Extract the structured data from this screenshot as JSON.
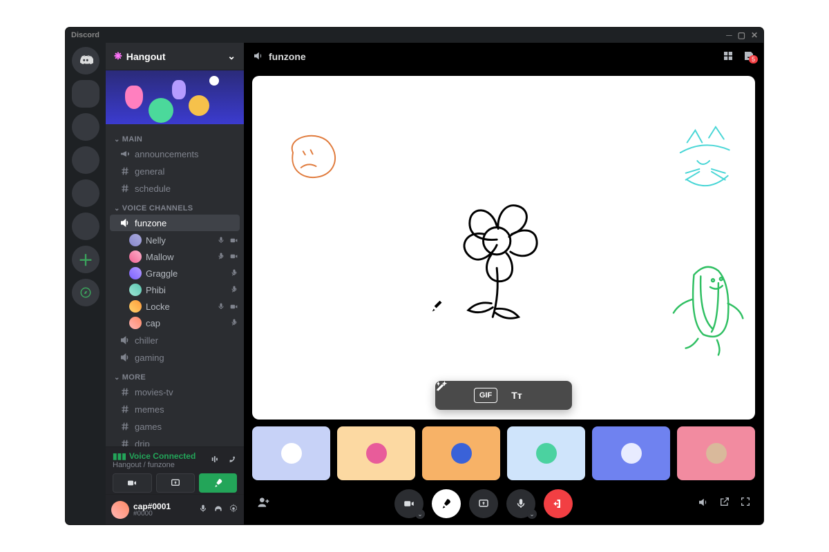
{
  "app_title": "Discord",
  "server_name": "Hangout",
  "inbox_badge": "5",
  "current_channel": {
    "icon": "speaker",
    "name": "funzone"
  },
  "categories": [
    {
      "id": "main",
      "label": "MAIN",
      "channels": [
        {
          "icon": "megaphone",
          "label": "announcements"
        },
        {
          "icon": "hash",
          "label": "general"
        },
        {
          "icon": "hash",
          "label": "schedule"
        }
      ]
    },
    {
      "id": "voice",
      "label": "VOICE CHANNELS",
      "channels": [
        {
          "icon": "speaker",
          "label": "funzone",
          "active": true,
          "members": [
            {
              "avatar": "av1",
              "name": "Nelly",
              "mic": "on",
              "cam": "on"
            },
            {
              "avatar": "av2",
              "name": "Mallow",
              "mic": "off",
              "cam": "on"
            },
            {
              "avatar": "av3",
              "name": "Graggle",
              "mic": "off",
              "cam": "off"
            },
            {
              "avatar": "av4",
              "name": "Phibi",
              "mic": "off",
              "cam": "off"
            },
            {
              "avatar": "av5",
              "name": "Locke",
              "mic": "on",
              "cam": "on"
            },
            {
              "avatar": "av6",
              "name": "cap",
              "mic": "off",
              "cam": "off"
            }
          ]
        },
        {
          "icon": "speaker",
          "label": "chiller"
        },
        {
          "icon": "speaker",
          "label": "gaming"
        }
      ]
    },
    {
      "id": "more",
      "label": "MORE",
      "channels": [
        {
          "icon": "hash",
          "label": "movies-tv"
        },
        {
          "icon": "hash",
          "label": "memes"
        },
        {
          "icon": "hash",
          "label": "games"
        },
        {
          "icon": "hash",
          "label": "drip"
        }
      ]
    }
  ],
  "voice_status": {
    "label": "Voice Connected",
    "sub": "Hangout / funzone"
  },
  "user": {
    "name": "cap#0001",
    "tag": "#0000"
  },
  "toolbar_labels": {
    "gif": "GIF",
    "text": "Tᴛ"
  },
  "participant_tiles": [
    "t1",
    "t2",
    "t3",
    "t4",
    "t5",
    "t6"
  ]
}
